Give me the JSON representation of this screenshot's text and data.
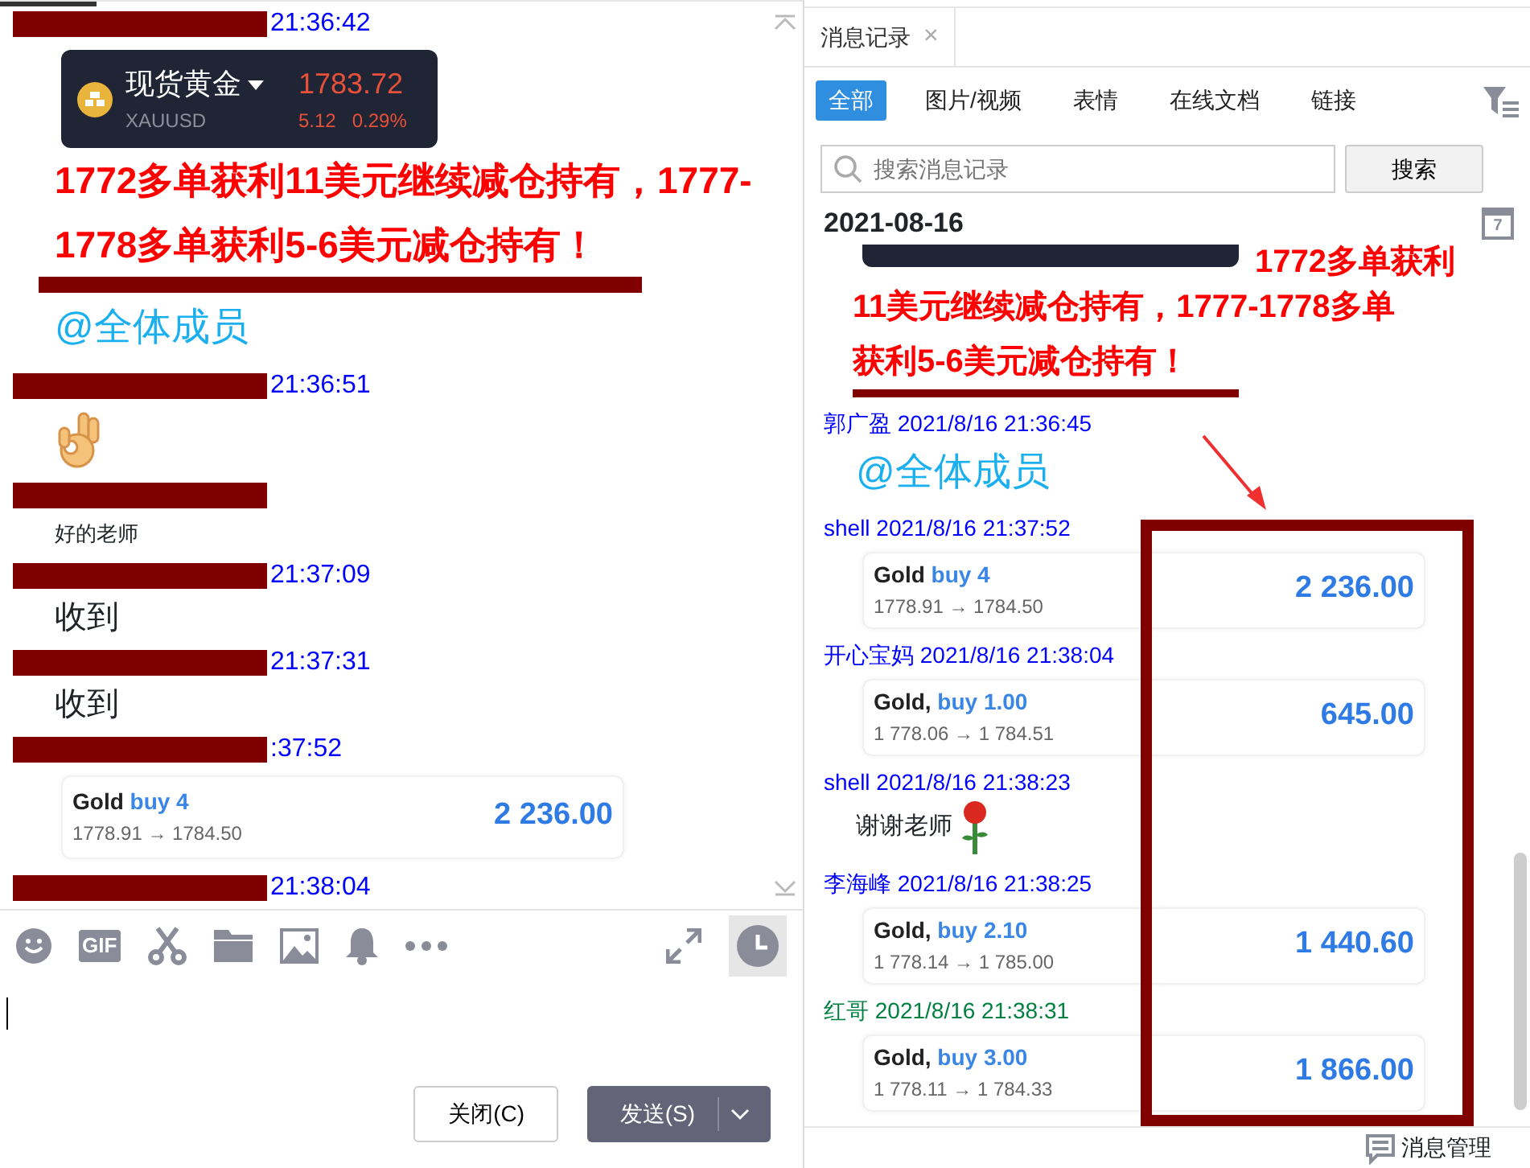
{
  "chat": {
    "messages": [
      {
        "redacted": true,
        "time": "21:36:42",
        "items": [
          {
            "kind": "ticker",
            "name": "现货黄金",
            "symbol": "XAUUSD",
            "price": "1783.72",
            "change": "5.12",
            "percent": "0.29%"
          },
          {
            "kind": "alert",
            "text": "1772多单获利11美元继续减仓持有，1777-1778多单获利5-6美元减仓持有！"
          },
          {
            "kind": "redaction"
          },
          {
            "kind": "mention",
            "text": "@全体成员"
          }
        ]
      },
      {
        "redacted": true,
        "time": "21:36:51",
        "items": [
          {
            "kind": "emoji"
          }
        ]
      },
      {
        "redacted": true,
        "items": [
          {
            "kind": "text",
            "text": "好的老师"
          }
        ]
      },
      {
        "redacted": true,
        "time": "21:37:09",
        "items": [
          {
            "kind": "big_text",
            "text": "收到"
          }
        ]
      },
      {
        "redacted": true,
        "time": "21:37:31",
        "items": [
          {
            "kind": "big_text",
            "text": "收到"
          }
        ]
      },
      {
        "redacted": true,
        "time": ":37:52",
        "items": [
          {
            "kind": "trade",
            "asset": "Gold",
            "side": "buy 4",
            "prices": "1778.91 → 1784.50",
            "profit": "2 236.00"
          }
        ]
      },
      {
        "redacted": true,
        "time": "21:38:04"
      }
    ]
  },
  "toolbar": {
    "gif_text": "GIF"
  },
  "buttons": [
    {
      "label": "关闭(C)",
      "kind": "secondary"
    },
    {
      "label": "发送(S)",
      "kind": "primary"
    }
  ],
  "history": {
    "tab": "消息记录",
    "close": "×",
    "filters": [
      {
        "label": "全部",
        "selected": true
      },
      {
        "label": "图片/视频",
        "selected": false
      },
      {
        "label": "表情",
        "selected": false
      },
      {
        "label": "在线文档",
        "selected": false
      },
      {
        "label": "链接",
        "selected": false
      }
    ],
    "search": {
      "placeholder": "搜索消息记录",
      "button": "搜索"
    },
    "date": "2021-08-16",
    "calendar_day": "7",
    "top_alert": [
      "1772多单获利",
      "11美元继续减仓持有，1777-1778多单",
      "获利5-6美元减仓持有！"
    ],
    "messages": [
      {
        "sender": "郭广盈 2021/8/16 21:36:45",
        "color": "#0000ff",
        "items": [
          {
            "kind": "mention",
            "text": "@全体成员"
          }
        ]
      },
      {
        "sender": "shell 2021/8/16 21:37:52",
        "color": "#0000ff",
        "items": [
          {
            "kind": "trade",
            "asset": "Gold",
            "side": "buy 4",
            "prices": "1778.91 → 1784.50",
            "profit": "2 236.00"
          }
        ]
      },
      {
        "sender": "开心宝妈 2021/8/16 21:38:04",
        "color": "#0000ff",
        "items": [
          {
            "kind": "trade",
            "asset": "Gold,",
            "side": "buy 1.00",
            "prices": "1 778.06 → 1 784.51",
            "profit": "645.00"
          }
        ]
      },
      {
        "sender": "shell 2021/8/16 21:38:23",
        "color": "#0000ff",
        "items": [
          {
            "kind": "text_rose",
            "text": "谢谢老师"
          }
        ]
      },
      {
        "sender": "李海峰 2021/8/16 21:38:25",
        "color": "#0000ff",
        "items": [
          {
            "kind": "trade",
            "asset": "Gold,",
            "side": "buy 2.10",
            "prices": "1 778.14 → 1 785.00",
            "profit": "1 440.60"
          }
        ]
      },
      {
        "sender": "红哥 2021/8/16 21:38:31",
        "color": "#008040",
        "items": [
          {
            "kind": "trade",
            "asset": "Gold,",
            "side": "buy 3.00",
            "prices": "1 778.11 → 1 784.33",
            "profit": "1 866.00"
          }
        ]
      }
    ],
    "footer": "消息管理"
  }
}
